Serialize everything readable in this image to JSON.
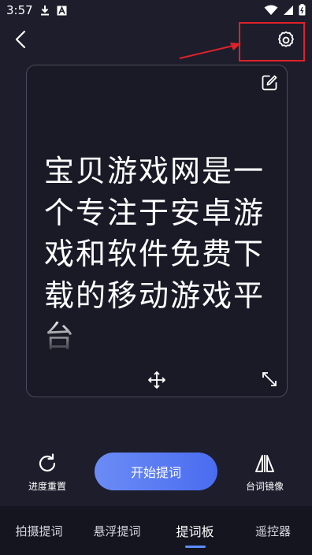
{
  "status_bar": {
    "time": "3:57"
  },
  "card": {
    "script_text": "宝贝游戏网是一个专注于安卓游戏和软件免费下载的移动游戏平台"
  },
  "controls": {
    "reset_label": "进度重置",
    "start_label": "开始提词",
    "mirror_label": "台词镜像"
  },
  "nav": {
    "tabs": [
      {
        "label": "拍摄提词",
        "active": false
      },
      {
        "label": "悬浮提词",
        "active": false
      },
      {
        "label": "提词板",
        "active": true
      },
      {
        "label": "遥控器",
        "active": false
      }
    ]
  },
  "colors": {
    "background": "#1d1d2b",
    "accent": "#4a6cf0",
    "highlight": "#e0212a"
  }
}
